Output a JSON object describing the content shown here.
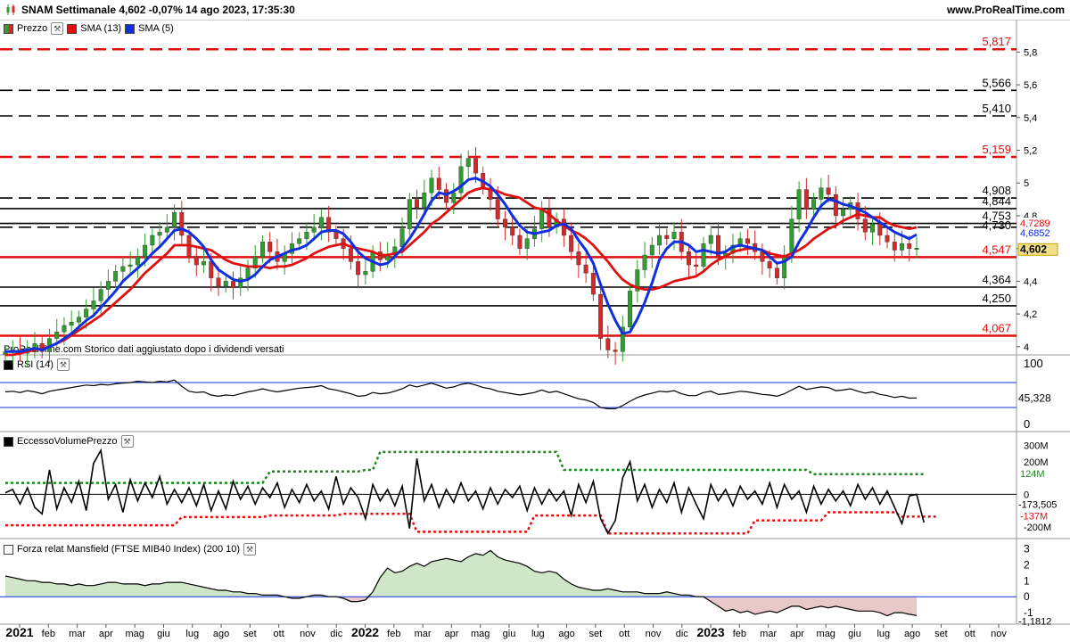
{
  "header": {
    "title": "SNAM Settimanale 4,602 -0,07% 14 ago 2023, 17:35:30",
    "site": "www.ProRealTime.com"
  },
  "legends": {
    "price": "Prezzo",
    "sma13": "SMA (13)",
    "sma5": "SMA (5)",
    "rsi": "RSI (14)",
    "volume": "EccessoVolumePrezzo",
    "mansfield": "Forza relat Mansfield (FTSE MIB40 Index) (200 10)",
    "watermark": "ProRealTime.com Storico dati aggiustato dopo i dividendi versati"
  },
  "colors": {
    "up": "#2e9e2e",
    "down": "#d22a2a",
    "sma13": "#e01010",
    "sma5": "#1030e0",
    "red_level": "#e01010",
    "black_level": "#000000",
    "last_price_tag": "#f5e08a",
    "vol_upper": "#1a8a1a",
    "vol_lower": "#e01010",
    "mansfield_pos": "#cfe6c8",
    "mansfield_neg": "#e8c8c8"
  },
  "chart_data": [
    {
      "type": "candlestick",
      "title": "SNAM Settimanale",
      "ylim": [
        3.95,
        5.9
      ],
      "y_ticks": [
        "4",
        "4,2",
        "4,4",
        "4,6",
        "4,8",
        "5",
        "5,2",
        "5,4",
        "5,6",
        "5,8"
      ],
      "x_labels": [
        "2021",
        "feb",
        "mar",
        "apr",
        "mag",
        "giu",
        "lug",
        "ago",
        "set",
        "ott",
        "nov",
        "dic",
        "2022",
        "feb",
        "mar",
        "apr",
        "mag",
        "giu",
        "lug",
        "ago",
        "set",
        "ott",
        "nov",
        "dic",
        "2023",
        "feb",
        "mar",
        "apr",
        "mag",
        "giu",
        "lug",
        "ago",
        "set",
        "ott",
        "nov"
      ],
      "levels": [
        {
          "value": 5.817,
          "label": "5,817",
          "style": "dashed",
          "color": "red"
        },
        {
          "value": 5.566,
          "label": "5,566",
          "style": "dashed",
          "color": "black"
        },
        {
          "value": 5.41,
          "label": "5,410",
          "style": "dashed",
          "color": "black"
        },
        {
          "value": 5.159,
          "label": "5,159",
          "style": "dashed",
          "color": "red"
        },
        {
          "value": 4.908,
          "label": "4,908",
          "style": "dashed",
          "color": "black"
        },
        {
          "value": 4.844,
          "label": "4,844",
          "style": "solid",
          "color": "black"
        },
        {
          "value": 4.753,
          "label": "4,753",
          "style": "solid",
          "color": "black"
        },
        {
          "value": 4.73,
          "label": "4,730",
          "style": "dashed",
          "color": "black"
        },
        {
          "value": 4.547,
          "label": "4,547",
          "style": "solid",
          "color": "red"
        },
        {
          "value": 4.364,
          "label": "4,364",
          "style": "solid",
          "color": "black"
        },
        {
          "value": 4.25,
          "label": "4,250",
          "style": "solid",
          "color": "black"
        },
        {
          "value": 4.067,
          "label": "4,067",
          "style": "solid",
          "color": "red"
        }
      ],
      "last_values": [
        {
          "label": "4,7289",
          "value": 4.7289,
          "color": "red"
        },
        {
          "label": "4,6852",
          "value": 4.6852,
          "color": "blue"
        },
        {
          "label": "4,602",
          "value": 4.602,
          "color": "price"
        }
      ],
      "closes": [
        3.97,
        3.98,
        3.96,
        3.99,
        4.02,
        3.97,
        4.05,
        4.09,
        4.13,
        4.15,
        4.18,
        4.23,
        4.28,
        4.35,
        4.4,
        4.46,
        4.49,
        4.5,
        4.55,
        4.62,
        4.68,
        4.7,
        4.73,
        4.82,
        4.68,
        4.55,
        4.5,
        4.52,
        4.42,
        4.37,
        4.4,
        4.36,
        4.42,
        4.48,
        4.55,
        4.64,
        4.58,
        4.52,
        4.57,
        4.63,
        4.66,
        4.7,
        4.73,
        4.79,
        4.7,
        4.66,
        4.6,
        4.52,
        4.44,
        4.46,
        4.58,
        4.53,
        4.56,
        4.61,
        4.72,
        4.9,
        4.85,
        4.94,
        5.03,
        4.96,
        4.88,
        4.94,
        5.1,
        5.15,
        5.06,
        4.97,
        4.9,
        4.78,
        4.73,
        4.68,
        4.6,
        4.66,
        4.72,
        4.84,
        4.73,
        4.78,
        4.68,
        4.58,
        4.5,
        4.45,
        4.32,
        4.05,
        3.98,
        3.97,
        4.12,
        4.34,
        4.47,
        4.56,
        4.62,
        4.68,
        4.66,
        4.7,
        4.58,
        4.5,
        4.49,
        4.63,
        4.68,
        4.55,
        4.57,
        4.62,
        4.66,
        4.63,
        4.58,
        4.52,
        4.48,
        4.42,
        4.56,
        4.78,
        4.96,
        4.84,
        4.9,
        4.97,
        4.93,
        4.8,
        4.84,
        4.88,
        4.78,
        4.7,
        4.75,
        4.68,
        4.64,
        4.59,
        4.63,
        4.6,
        4.602
      ],
      "sma13": [
        3.95,
        3.95,
        3.96,
        3.97,
        3.98,
        3.99,
        4.0,
        4.02,
        4.04,
        4.07,
        4.1,
        4.13,
        4.16,
        4.19,
        4.23,
        4.27,
        4.31,
        4.35,
        4.4,
        4.45,
        4.49,
        4.53,
        4.57,
        4.62,
        4.62,
        4.62,
        4.61,
        4.6,
        4.59,
        4.56,
        4.53,
        4.51,
        4.5,
        4.49,
        4.49,
        4.49,
        4.48,
        4.49,
        4.49,
        4.5,
        4.52,
        4.54,
        4.57,
        4.59,
        4.61,
        4.62,
        4.63,
        4.61,
        4.6,
        4.59,
        4.58,
        4.56,
        4.56,
        4.57,
        4.58,
        4.62,
        4.66,
        4.7,
        4.75,
        4.78,
        4.82,
        4.86,
        4.9,
        4.94,
        4.96,
        4.97,
        4.96,
        4.95,
        4.93,
        4.92,
        4.91,
        4.88,
        4.85,
        4.84,
        4.81,
        4.77,
        4.74,
        4.71,
        4.69,
        4.66,
        4.62,
        4.57,
        4.52,
        4.46,
        4.41,
        4.38,
        4.36,
        4.35,
        4.35,
        4.36,
        4.38,
        4.4,
        4.41,
        4.42,
        4.43,
        4.46,
        4.5,
        4.53,
        4.55,
        4.58,
        4.59,
        4.6,
        4.6,
        4.59,
        4.57,
        4.56,
        4.55,
        4.57,
        4.59,
        4.62,
        4.66,
        4.69,
        4.72,
        4.74,
        4.77,
        4.79,
        4.81,
        4.8,
        4.79,
        4.79,
        4.76,
        4.74,
        4.73,
        4.72,
        4.7289
      ],
      "sma5": [
        3.97,
        3.97,
        3.97,
        3.98,
        3.99,
        3.98,
        4.0,
        4.02,
        4.05,
        4.08,
        4.12,
        4.16,
        4.19,
        4.24,
        4.29,
        4.34,
        4.4,
        4.44,
        4.48,
        4.52,
        4.57,
        4.61,
        4.66,
        4.71,
        4.72,
        4.7,
        4.66,
        4.61,
        4.53,
        4.47,
        4.44,
        4.41,
        4.4,
        4.41,
        4.44,
        4.49,
        4.53,
        4.55,
        4.57,
        4.59,
        4.6,
        4.62,
        4.66,
        4.7,
        4.71,
        4.71,
        4.69,
        4.64,
        4.58,
        4.54,
        4.52,
        4.5,
        4.51,
        4.55,
        4.6,
        4.66,
        4.73,
        4.81,
        4.89,
        4.94,
        4.93,
        4.95,
        4.98,
        5.02,
        5.03,
        5.01,
        4.98,
        4.93,
        4.87,
        4.8,
        4.74,
        4.7,
        4.69,
        4.7,
        4.71,
        4.74,
        4.75,
        4.72,
        4.65,
        4.59,
        4.51,
        4.38,
        4.26,
        4.16,
        4.08,
        4.09,
        4.17,
        4.27,
        4.39,
        4.53,
        4.6,
        4.64,
        4.64,
        4.62,
        4.58,
        4.59,
        4.58,
        4.57,
        4.58,
        4.61,
        4.62,
        4.61,
        4.6,
        4.59,
        4.55,
        4.51,
        4.52,
        4.55,
        4.64,
        4.71,
        4.79,
        4.86,
        4.9,
        4.89,
        4.87,
        4.86,
        4.84,
        4.82,
        4.79,
        4.76,
        4.73,
        4.7,
        4.68,
        4.66,
        4.6852
      ]
    },
    {
      "type": "line",
      "title": "RSI (14)",
      "ylim": [
        0,
        100
      ],
      "y_ticks": [
        "100",
        "0"
      ],
      "levels": [
        70,
        30
      ],
      "last_label": "45,328",
      "values": [
        55,
        56,
        54,
        57,
        55,
        52,
        56,
        58,
        60,
        62,
        64,
        66,
        65,
        67,
        66,
        68,
        69,
        70,
        72,
        71,
        70,
        72,
        71,
        74,
        64,
        56,
        54,
        55,
        50,
        48,
        50,
        49,
        52,
        55,
        57,
        60,
        57,
        55,
        57,
        59,
        61,
        62,
        63,
        65,
        60,
        58,
        55,
        52,
        48,
        49,
        54,
        52,
        53,
        56,
        60,
        66,
        63,
        66,
        69,
        65,
        61,
        63,
        67,
        69,
        66,
        62,
        60,
        56,
        54,
        52,
        50,
        52,
        54,
        58,
        54,
        56,
        52,
        48,
        44,
        42,
        38,
        30,
        28,
        28,
        33,
        40,
        46,
        50,
        53,
        56,
        55,
        57,
        52,
        49,
        49,
        54,
        56,
        51,
        52,
        54,
        56,
        55,
        53,
        51,
        50,
        48,
        52,
        58,
        64,
        59,
        61,
        63,
        62,
        57,
        58,
        60,
        56,
        53,
        55,
        51,
        49,
        46,
        48,
        45,
        45.328
      ]
    },
    {
      "type": "line",
      "title": "EccessoVolumePrezzo",
      "ylim": [
        -250,
        320
      ],
      "y_ticks": [
        "300M",
        "200M",
        "0",
        "-200M"
      ],
      "last_labels": [
        "124M",
        "-173,505",
        "-137M"
      ],
      "values": [
        10,
        30,
        -60,
        40,
        -80,
        -120,
        150,
        -90,
        40,
        -50,
        80,
        -100,
        190,
        270,
        -30,
        60,
        -110,
        90,
        -40,
        70,
        -20,
        110,
        -60,
        30,
        -50,
        40,
        -70,
        60,
        -100,
        20,
        -90,
        80,
        -30,
        50,
        -60,
        40,
        -20,
        70,
        -80,
        30,
        -50,
        60,
        -40,
        20,
        -90,
        110,
        -60,
        40,
        -20,
        -150,
        60,
        -40,
        30,
        -70,
        50,
        -210,
        220,
        -40,
        60,
        -80,
        30,
        -50,
        70,
        -40,
        20,
        -90,
        40,
        -60,
        30,
        -20,
        50,
        -100,
        40,
        -60,
        30,
        -40,
        20,
        -130,
        60,
        -50,
        80,
        -150,
        -240,
        -160,
        100,
        200,
        -40,
        60,
        -80,
        30,
        -50,
        70,
        -110,
        40,
        -60,
        -150,
        60,
        -40,
        30,
        -70,
        50,
        -30,
        20,
        -60,
        70,
        -80,
        60,
        -30,
        20,
        -110,
        50,
        -60,
        30,
        -40,
        20,
        -70,
        60,
        -30,
        40,
        -60,
        20,
        -80,
        -180,
        -10,
        0,
        -173.505
      ],
      "upper": [
        70,
        70,
        70,
        70,
        70,
        70,
        70,
        70,
        70,
        70,
        70,
        70,
        70,
        70,
        70,
        70,
        70,
        70,
        70,
        70,
        70,
        70,
        70,
        70,
        70,
        70,
        70,
        70,
        70,
        70,
        70,
        70,
        70,
        70,
        70,
        70,
        140,
        140,
        140,
        140,
        140,
        140,
        140,
        140,
        140,
        140,
        140,
        140,
        140,
        150,
        150,
        260,
        260,
        260,
        260,
        260,
        260,
        260,
        260,
        260,
        260,
        260,
        260,
        260,
        260,
        260,
        260,
        260,
        260,
        260,
        260,
        260,
        260,
        260,
        260,
        260,
        150,
        150,
        150,
        150,
        150,
        150,
        150,
        150,
        150,
        150,
        150,
        150,
        150,
        150,
        150,
        150,
        150,
        150,
        150,
        150,
        150,
        150,
        150,
        150,
        150,
        150,
        150,
        150,
        150,
        150,
        150,
        150,
        150,
        150,
        124,
        124,
        124,
        124,
        124,
        124,
        124,
        124,
        124,
        124,
        124,
        124,
        124,
        124,
        124,
        124
      ],
      "lower": [
        -190,
        -190,
        -190,
        -190,
        -190,
        -190,
        -190,
        -190,
        -190,
        -190,
        -190,
        -190,
        -190,
        -190,
        -190,
        -190,
        -190,
        -190,
        -190,
        -190,
        -190,
        -190,
        -190,
        -190,
        -140,
        -140,
        -140,
        -140,
        -140,
        -140,
        -140,
        -140,
        -140,
        -140,
        -140,
        -140,
        -130,
        -130,
        -130,
        -130,
        -130,
        -130,
        -130,
        -130,
        -130,
        -130,
        -120,
        -120,
        -120,
        -120,
        -120,
        -120,
        -120,
        -120,
        -120,
        -120,
        -230,
        -230,
        -230,
        -230,
        -230,
        -230,
        -230,
        -230,
        -230,
        -230,
        -230,
        -230,
        -230,
        -230,
        -230,
        -230,
        -130,
        -130,
        -130,
        -130,
        -130,
        -130,
        -130,
        -130,
        -130,
        -130,
        -240,
        -240,
        -240,
        -240,
        -240,
        -240,
        -240,
        -240,
        -240,
        -240,
        -240,
        -240,
        -240,
        -240,
        -240,
        -240,
        -240,
        -240,
        -240,
        -240,
        -160,
        -160,
        -160,
        -160,
        -160,
        -160,
        -160,
        -160,
        -160,
        -160,
        -110,
        -110,
        -110,
        -110,
        -110,
        -110,
        -110,
        -110,
        -110,
        -110,
        -137,
        -137,
        -137,
        -137,
        -137,
        -137
      ]
    },
    {
      "type": "area",
      "title": "Forza relat Mansfield (FTSE MIB40 Index) (200 10)",
      "ylim": [
        -1.5,
        3.2
      ],
      "y_ticks": [
        "3",
        "2",
        "1",
        "0",
        "-1"
      ],
      "last_label": "-1,1812",
      "values": [
        1.3,
        1.2,
        1.1,
        1.0,
        1.0,
        0.9,
        0.9,
        0.8,
        0.8,
        0.7,
        0.8,
        0.7,
        0.7,
        0.8,
        0.9,
        0.9,
        0.8,
        0.8,
        0.8,
        0.7,
        0.8,
        0.8,
        0.9,
        0.9,
        0.9,
        0.8,
        0.7,
        0.6,
        0.5,
        0.4,
        0.4,
        0.3,
        0.3,
        0.2,
        0.2,
        0.1,
        0.1,
        0.1,
        0.0,
        -0.1,
        -0.1,
        0.0,
        0.1,
        0.1,
        0.0,
        0.0,
        -0.1,
        -0.3,
        -0.3,
        -0.2,
        0.3,
        1.2,
        1.8,
        1.5,
        1.6,
        1.9,
        2.1,
        1.9,
        2.2,
        2.3,
        2.4,
        2.3,
        2.2,
        2.5,
        2.7,
        2.6,
        2.9,
        2.5,
        2.3,
        2.2,
        2.1,
        1.9,
        1.6,
        1.5,
        1.6,
        1.5,
        1.1,
        0.8,
        0.6,
        0.5,
        0.4,
        0.4,
        0.5,
        0.4,
        0.3,
        0.3,
        0.3,
        0.2,
        0.2,
        0.2,
        0.3,
        0.2,
        0.1,
        0.1,
        0.0,
        0.0,
        -0.3,
        -0.6,
        -0.9,
        -0.8,
        -1.0,
        -0.9,
        -1.1,
        -1.0,
        -0.9,
        -1.0,
        -0.8,
        -0.6,
        -0.6,
        -0.8,
        -0.7,
        -0.6,
        -0.7,
        -0.6,
        -0.7,
        -0.8,
        -0.9,
        -0.9,
        -0.9,
        -1.0,
        -1.2,
        -1.0,
        -1.0,
        -1.1,
        -1.1812
      ]
    }
  ]
}
